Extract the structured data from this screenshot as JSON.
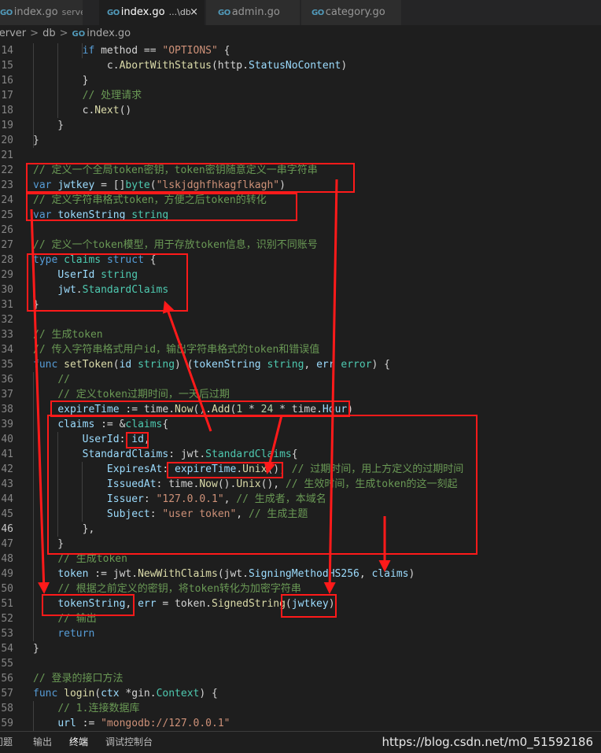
{
  "tabs": [
    {
      "name": "tab-index-server",
      "label": "index.go",
      "desc": "server",
      "active": false
    },
    {
      "name": "tab-index-db",
      "label": "index.go",
      "desc": "...\\db",
      "active": true
    },
    {
      "name": "tab-admin",
      "label": "admin.go",
      "desc": "",
      "active": false
    },
    {
      "name": "tab-category",
      "label": "category.go",
      "desc": "",
      "active": false
    }
  ],
  "tab_icon": "GO",
  "close_glyph": "×",
  "breadcrumb": {
    "parts": [
      "server",
      "db",
      "index.go"
    ],
    "separator": ">"
  },
  "lines": [
    {
      "n": "14",
      "s": [
        [
          "        ",
          "p"
        ],
        [
          "if",
          "k"
        ],
        [
          " method == ",
          "p"
        ],
        [
          "\"OPTIONS\"",
          "s"
        ],
        [
          " {",
          "p"
        ]
      ]
    },
    {
      "n": "15",
      "s": [
        [
          "            c.",
          "p"
        ],
        [
          "AbortWithStatus",
          "f"
        ],
        [
          "(http.",
          "p"
        ],
        [
          "StatusNoContent",
          "v"
        ],
        [
          ")",
          "p"
        ]
      ]
    },
    {
      "n": "16",
      "s": [
        [
          "        }",
          "p"
        ]
      ]
    },
    {
      "n": "17",
      "s": [
        [
          "        ",
          "p"
        ],
        [
          "// 处理请求",
          "c"
        ]
      ]
    },
    {
      "n": "18",
      "s": [
        [
          "        c.",
          "p"
        ],
        [
          "Next",
          "f"
        ],
        [
          "()",
          "p"
        ]
      ]
    },
    {
      "n": "19",
      "s": [
        [
          "    }",
          "p"
        ]
      ]
    },
    {
      "n": "20",
      "s": [
        [
          "}",
          "p"
        ]
      ]
    },
    {
      "n": "21",
      "s": []
    },
    {
      "n": "22",
      "s": [
        [
          "// 定义一个全局token密钥，token密钥随意定义一串字符串",
          "c"
        ]
      ]
    },
    {
      "n": "23",
      "s": [
        [
          "var",
          "k"
        ],
        [
          " ",
          "p"
        ],
        [
          "jwtkey",
          "v"
        ],
        [
          " = []",
          "p"
        ],
        [
          "byte",
          "t"
        ],
        [
          "(",
          "p"
        ],
        [
          "\"lskjdghfhkagflkagh\"",
          "s"
        ],
        [
          ")",
          "p"
        ]
      ]
    },
    {
      "n": "24",
      "s": [
        [
          "// 定义字符串格式token，方便之后token的转化",
          "c"
        ]
      ]
    },
    {
      "n": "25",
      "s": [
        [
          "var",
          "k"
        ],
        [
          " ",
          "p"
        ],
        [
          "tokenString",
          "v"
        ],
        [
          " ",
          "p"
        ],
        [
          "string",
          "t"
        ]
      ]
    },
    {
      "n": "26",
      "s": []
    },
    {
      "n": "27",
      "s": [
        [
          "// 定义一个token模型，用于存放token信息，识别不同账号",
          "c"
        ]
      ]
    },
    {
      "n": "28",
      "s": [
        [
          "type",
          "k"
        ],
        [
          " ",
          "p"
        ],
        [
          "claims",
          "t"
        ],
        [
          " ",
          "p"
        ],
        [
          "struct",
          "k"
        ],
        [
          " {",
          "p"
        ]
      ]
    },
    {
      "n": "29",
      "s": [
        [
          "    ",
          "p"
        ],
        [
          "UserId",
          "v"
        ],
        [
          " ",
          "p"
        ],
        [
          "string",
          "t"
        ]
      ]
    },
    {
      "n": "30",
      "s": [
        [
          "    ",
          "p"
        ],
        [
          "jwt",
          "v"
        ],
        [
          ".",
          "p"
        ],
        [
          "StandardClaims",
          "t"
        ]
      ]
    },
    {
      "n": "31",
      "s": [
        [
          "}",
          "p"
        ]
      ]
    },
    {
      "n": "32",
      "s": []
    },
    {
      "n": "33",
      "s": [
        [
          "// 生成token",
          "c"
        ]
      ]
    },
    {
      "n": "34",
      "s": [
        [
          "// 传入字符串格式用户id，输出字符串格式的token和错误值",
          "c"
        ]
      ]
    },
    {
      "n": "35",
      "s": [
        [
          "func",
          "k"
        ],
        [
          " ",
          "p"
        ],
        [
          "setToken",
          "f"
        ],
        [
          "(",
          "p"
        ],
        [
          "id",
          "v"
        ],
        [
          " ",
          "p"
        ],
        [
          "string",
          "t"
        ],
        [
          ") (",
          "p"
        ],
        [
          "tokenString",
          "v"
        ],
        [
          " ",
          "p"
        ],
        [
          "string",
          "t"
        ],
        [
          ", ",
          "p"
        ],
        [
          "err",
          "v"
        ],
        [
          " ",
          "p"
        ],
        [
          "error",
          "t"
        ],
        [
          ") {",
          "p"
        ]
      ]
    },
    {
      "n": "36",
      "s": [
        [
          "    ",
          "p"
        ],
        [
          "//",
          "c"
        ]
      ]
    },
    {
      "n": "37",
      "s": [
        [
          "    ",
          "p"
        ],
        [
          "// 定义token过期时间，一天后过期",
          "c"
        ]
      ]
    },
    {
      "n": "38",
      "s": [
        [
          "    ",
          "p"
        ],
        [
          "expireTime",
          "v"
        ],
        [
          " := time.",
          "p"
        ],
        [
          "Now",
          "f"
        ],
        [
          "().",
          "p"
        ],
        [
          "Add",
          "f"
        ],
        [
          "(",
          "p"
        ],
        [
          "1",
          "n"
        ],
        [
          " * ",
          "p"
        ],
        [
          "24",
          "n"
        ],
        [
          " * time.",
          "p"
        ],
        [
          "Hour",
          "v"
        ],
        [
          ")",
          "p"
        ]
      ]
    },
    {
      "n": "39",
      "s": [
        [
          "    ",
          "p"
        ],
        [
          "claims",
          "v"
        ],
        [
          " := &",
          "p"
        ],
        [
          "claims",
          "t"
        ],
        [
          "{",
          "p"
        ]
      ]
    },
    {
      "n": "40",
      "s": [
        [
          "        ",
          "p"
        ],
        [
          "UserId",
          "v"
        ],
        [
          ": ",
          "p"
        ],
        [
          "id",
          "v"
        ],
        [
          ",",
          "p"
        ]
      ]
    },
    {
      "n": "41",
      "s": [
        [
          "        ",
          "p"
        ],
        [
          "StandardClaims",
          "v"
        ],
        [
          ": jwt.",
          "p"
        ],
        [
          "StandardClaims",
          "t"
        ],
        [
          "{",
          "p"
        ]
      ]
    },
    {
      "n": "42",
      "s": [
        [
          "            ",
          "p"
        ],
        [
          "ExpiresAt",
          "v"
        ],
        [
          ": ",
          "p"
        ],
        [
          "expireTime",
          "v"
        ],
        [
          ".",
          "p"
        ],
        [
          "Unix",
          "f"
        ],
        [
          "(), ",
          "p"
        ],
        [
          "// 过期时间，用上方定义的过期时间",
          "c"
        ]
      ]
    },
    {
      "n": "43",
      "s": [
        [
          "            ",
          "p"
        ],
        [
          "IssuedAt",
          "v"
        ],
        [
          ": time.",
          "p"
        ],
        [
          "Now",
          "f"
        ],
        [
          "().",
          "p"
        ],
        [
          "Unix",
          "f"
        ],
        [
          "(), ",
          "p"
        ],
        [
          "// 生效时间，生成token的这一刻起",
          "c"
        ]
      ]
    },
    {
      "n": "44",
      "s": [
        [
          "            ",
          "p"
        ],
        [
          "Issuer",
          "v"
        ],
        [
          ": ",
          "p"
        ],
        [
          "\"127.0.0.1\"",
          "s"
        ],
        [
          ", ",
          "p"
        ],
        [
          "// 生成者，本域名",
          "c"
        ]
      ]
    },
    {
      "n": "45",
      "s": [
        [
          "            ",
          "p"
        ],
        [
          "Subject",
          "v"
        ],
        [
          ": ",
          "p"
        ],
        [
          "\"user token\"",
          "s"
        ],
        [
          ", ",
          "p"
        ],
        [
          "// 生成主题",
          "c"
        ]
      ]
    },
    {
      "n": "46",
      "s": [
        [
          "        },",
          "p"
        ]
      ],
      "cur": true
    },
    {
      "n": "47",
      "s": [
        [
          "    }",
          "p"
        ]
      ]
    },
    {
      "n": "48",
      "s": [
        [
          "    ",
          "p"
        ],
        [
          "// 生成token",
          "c"
        ]
      ]
    },
    {
      "n": "49",
      "s": [
        [
          "    ",
          "p"
        ],
        [
          "token",
          "v"
        ],
        [
          " := jwt.",
          "p"
        ],
        [
          "NewWithClaims",
          "f"
        ],
        [
          "(jwt.",
          "p"
        ],
        [
          "SigningMethodHS256",
          "v"
        ],
        [
          ", ",
          "p"
        ],
        [
          "claims",
          "v"
        ],
        [
          ")",
          "p"
        ]
      ]
    },
    {
      "n": "50",
      "s": [
        [
          "    ",
          "p"
        ],
        [
          "// 根据之前定义的密钥，将token转化为加密字符串",
          "c"
        ]
      ]
    },
    {
      "n": "51",
      "s": [
        [
          "    ",
          "p"
        ],
        [
          "tokenString",
          "v"
        ],
        [
          ", ",
          "p"
        ],
        [
          "err",
          "v"
        ],
        [
          " = token.",
          "p"
        ],
        [
          "SignedString",
          "f"
        ],
        [
          "(",
          "p"
        ],
        [
          "jwtkey",
          "v"
        ],
        [
          ")",
          "p"
        ]
      ]
    },
    {
      "n": "52",
      "s": [
        [
          "    ",
          "p"
        ],
        [
          "// 输出",
          "c"
        ]
      ]
    },
    {
      "n": "53",
      "s": [
        [
          "    ",
          "p"
        ],
        [
          "return",
          "k"
        ]
      ]
    },
    {
      "n": "54",
      "s": [
        [
          "}",
          "p"
        ]
      ]
    },
    {
      "n": "55",
      "s": []
    },
    {
      "n": "56",
      "s": [
        [
          "// 登录的接口方法",
          "c"
        ]
      ]
    },
    {
      "n": "57",
      "s": [
        [
          "func",
          "k"
        ],
        [
          " ",
          "p"
        ],
        [
          "login",
          "f"
        ],
        [
          "(",
          "p"
        ],
        [
          "ctx",
          "v"
        ],
        [
          " *gin.",
          "p"
        ],
        [
          "Context",
          "t"
        ],
        [
          ") {",
          "p"
        ]
      ]
    },
    {
      "n": "58",
      "s": [
        [
          "    ",
          "p"
        ],
        [
          "// 1.连接数据库",
          "c"
        ]
      ]
    },
    {
      "n": "59",
      "s": [
        [
          "    ",
          "p"
        ],
        [
          "url",
          "v"
        ],
        [
          " := ",
          "p"
        ],
        [
          "\"mongodb://127.0.0.1\"",
          "s"
        ]
      ]
    }
  ],
  "panel_tabs": [
    "问题",
    "输出",
    "终端",
    "调试控制台"
  ],
  "active_panel": "终端",
  "watermark": "https://blog.csdn.net/m0_51592186",
  "colors": {
    "keyword": "#569cd6",
    "type": "#4ec9b0",
    "function": "#dcdcaa",
    "variable": "#9cdcfe",
    "string": "#ce9178",
    "comment": "#6a9955",
    "number": "#b5cea8",
    "plain": "#d4d4d4",
    "annotation": "#ff1a1a"
  }
}
